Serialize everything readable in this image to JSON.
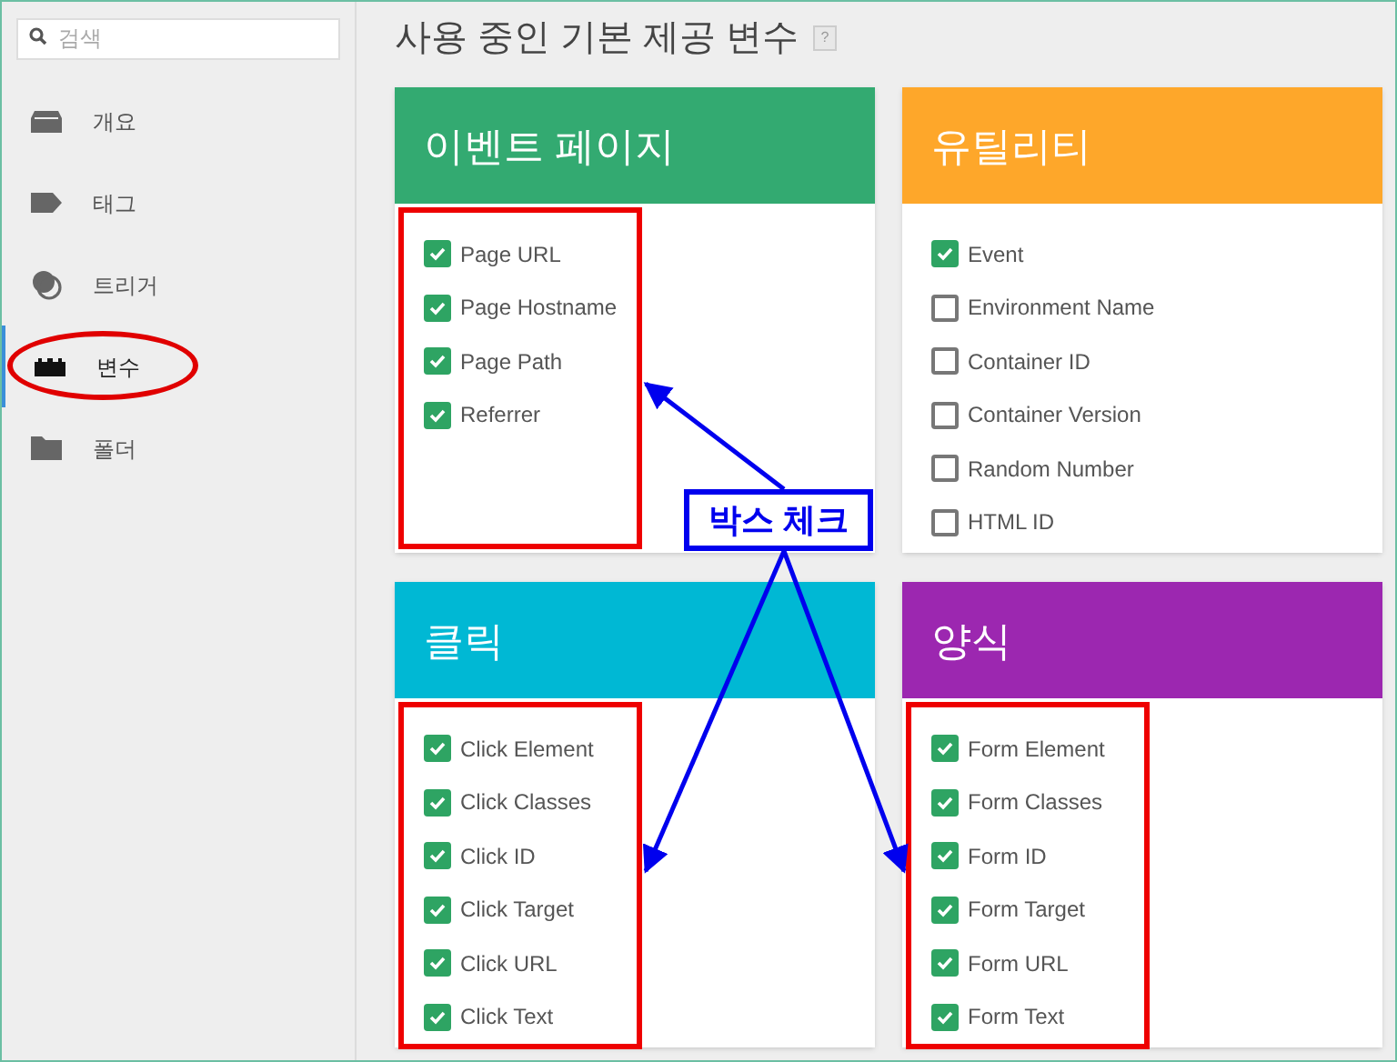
{
  "sidebar": {
    "search": {
      "placeholder": "검색"
    },
    "items": [
      {
        "label": "개요",
        "kind": "overview",
        "selected": false,
        "circled": false
      },
      {
        "label": "태그",
        "kind": "tag",
        "selected": false,
        "circled": false
      },
      {
        "label": "트리거",
        "kind": "trigger",
        "selected": false,
        "circled": false
      },
      {
        "label": "변수",
        "kind": "variable",
        "selected": true,
        "circled": true
      },
      {
        "label": "폴더",
        "kind": "folder",
        "selected": false,
        "circled": false
      }
    ]
  },
  "page_title": "사용 중인 기본 제공 변수",
  "help_badge": "?",
  "cards": [
    {
      "title": "이벤트 페이지",
      "color": "#33aa71",
      "highlighted": true,
      "variables": [
        {
          "label": "Page URL",
          "checked": true
        },
        {
          "label": "Page Hostname",
          "checked": true
        },
        {
          "label": "Page Path",
          "checked": true
        },
        {
          "label": "Referrer",
          "checked": true
        }
      ]
    },
    {
      "title": "유틸리티",
      "color": "#fea72a",
      "highlighted": false,
      "variables": [
        {
          "label": "Event",
          "checked": true
        },
        {
          "label": "Environment Name",
          "checked": false
        },
        {
          "label": "Container ID",
          "checked": false
        },
        {
          "label": "Container Version",
          "checked": false
        },
        {
          "label": "Random Number",
          "checked": false
        },
        {
          "label": "HTML ID",
          "checked": false
        }
      ]
    },
    {
      "title": "클릭",
      "color": "#00b8d4",
      "highlighted": true,
      "variables": [
        {
          "label": "Click Element",
          "checked": true
        },
        {
          "label": "Click Classes",
          "checked": true
        },
        {
          "label": "Click ID",
          "checked": true
        },
        {
          "label": "Click Target",
          "checked": true
        },
        {
          "label": "Click URL",
          "checked": true
        },
        {
          "label": "Click Text",
          "checked": true
        }
      ]
    },
    {
      "title": "양식",
      "color": "#9c27b0",
      "highlighted": true,
      "variables": [
        {
          "label": "Form Element",
          "checked": true
        },
        {
          "label": "Form Classes",
          "checked": true
        },
        {
          "label": "Form ID",
          "checked": true
        },
        {
          "label": "Form Target",
          "checked": true
        },
        {
          "label": "Form URL",
          "checked": true
        },
        {
          "label": "Form Text",
          "checked": true
        }
      ]
    }
  ],
  "callout": {
    "label": "박스 체크"
  }
}
